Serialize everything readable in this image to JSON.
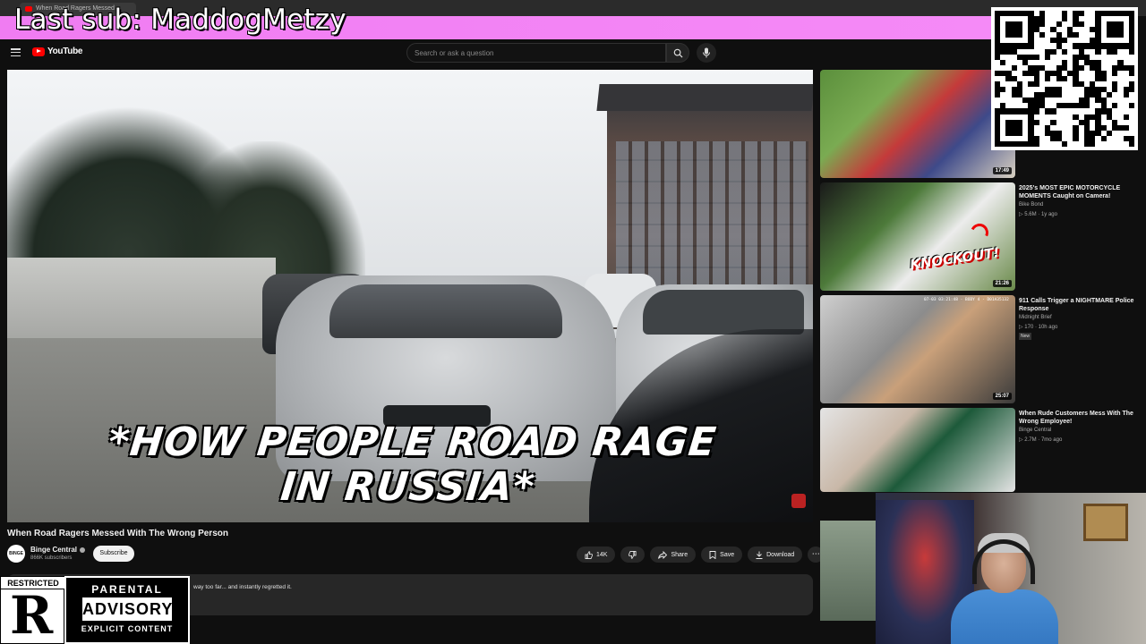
{
  "browser": {
    "tab_title": "When Road Ragers Messed"
  },
  "overlay": {
    "last_sub": "Last sub: MaddogMetzy"
  },
  "header": {
    "logo_text": "YouTube",
    "search_placeholder": "Search or ask a question"
  },
  "player": {
    "caption_line1": "*HOW PEOPLE ROAD RAGE",
    "caption_line2": "IN RUSSIA*"
  },
  "video": {
    "title": "When Road Ragers Messed With The Wrong Person",
    "channel": "Binge Central",
    "channel_avatar_text": "BINGE",
    "subscribers": "866K subscribers",
    "subscribe_label": "Subscribe",
    "likes": "14K",
    "share_label": "Share",
    "save_label": "Save",
    "download_label": "Download",
    "more_label": "⋯",
    "description": "way too far... and instantly regretted it."
  },
  "recommendations": [
    {
      "duration": "17:49",
      "title": "",
      "channel": "",
      "meta": ""
    },
    {
      "duration": "21:26",
      "title": "2025's MOST EPIC MOTORCYCLE MOMENTS Caught on Camera!",
      "channel": "Bike Bond",
      "meta": "▷ 5.6M · 1y ago",
      "overlay": "KNOCKOUT!"
    },
    {
      "duration": "25:07",
      "title": "911 Calls Trigger a NIGHTMARE Police Response",
      "channel": "Midnight Brief",
      "meta": "▷ 170 · 10h ago",
      "badge": "New",
      "overlay": "07-03 03:21:48 · BODY 4 · D01A35132"
    },
    {
      "duration": "",
      "title": "When Rude Customers Mess With The Wrong Employee!",
      "channel": "Binge Central",
      "meta": "▷ 2.7M · 7mo ago"
    }
  ],
  "stream_overlays": {
    "restricted_label": "RESTRICTED",
    "restricted_letter": "R",
    "advisory_top": "PARENTAL",
    "advisory_mid": "ADVISORY",
    "advisory_bottom": "EXPLICIT CONTENT"
  },
  "colors": {
    "yt_red": "#ff0000",
    "banner_pink": "#f07cf2",
    "background": "#0f0f0f"
  },
  "icons": [
    "menu-icon",
    "youtube-logo-icon",
    "search-icon",
    "mic-icon",
    "like-icon",
    "dislike-icon",
    "share-icon",
    "save-icon",
    "download-icon",
    "more-icon",
    "verified-icon",
    "qr-code-icon"
  ]
}
